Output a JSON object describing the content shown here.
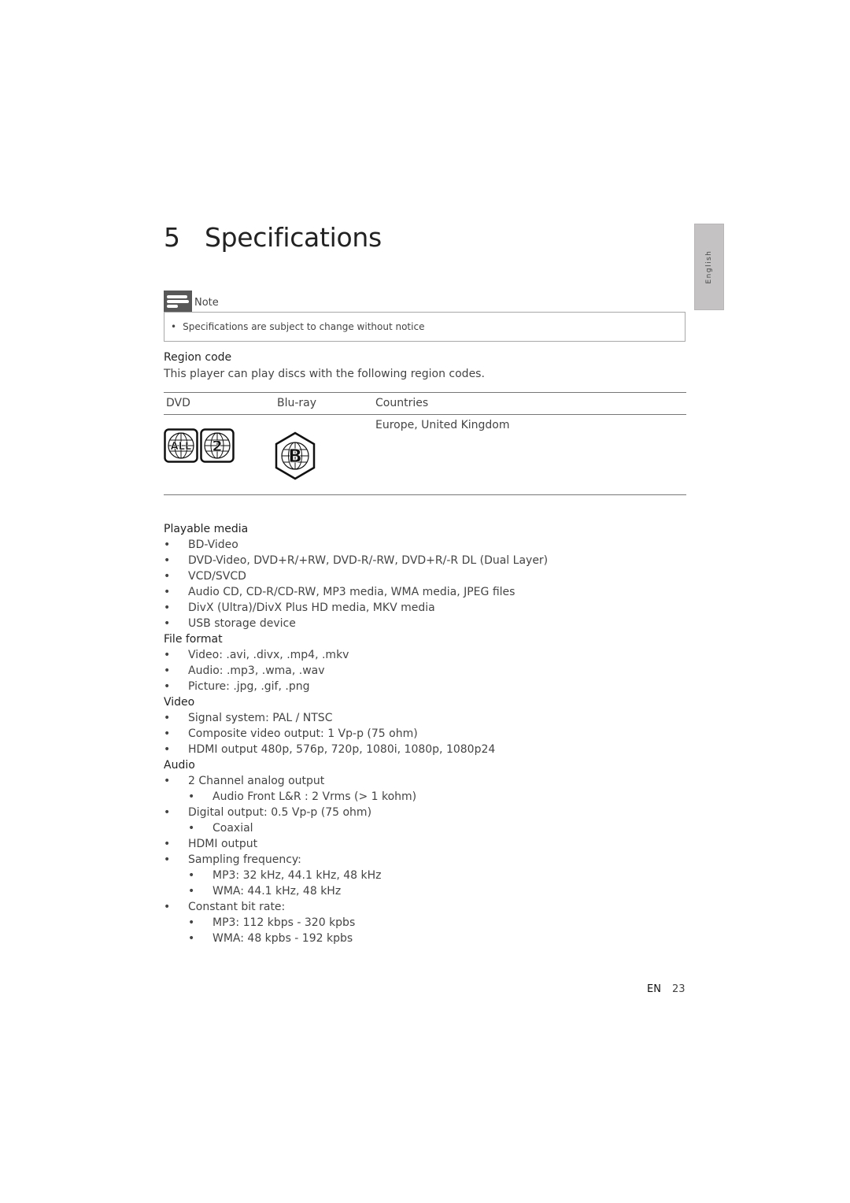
{
  "page": {
    "chapter_number": "5",
    "title": "Specifications",
    "language_tab": "English"
  },
  "note": {
    "icon": "note-icon",
    "label": "Note",
    "bullet": "•",
    "text": "Specifications are subject to change without notice"
  },
  "region": {
    "heading": "Region code",
    "intro": "This player can play discs with the following region codes.",
    "table": {
      "headers": [
        "DVD",
        "Blu-ray",
        "Countries"
      ],
      "rows": [
        {
          "dvd_icons": [
            "region-all-globe-icon",
            "region-2-globe-icon"
          ],
          "dvd_codes": [
            "ALL",
            "2"
          ],
          "bluray_icon": "region-b-hexagon-icon",
          "bluray_code": "B",
          "countries": "Europe, United Kingdom"
        }
      ]
    }
  },
  "sections": [
    {
      "heading": "Playable media",
      "items": [
        {
          "level": 1,
          "text": "BD-Video"
        },
        {
          "level": 1,
          "text": "DVD-Video, DVD+R/+RW, DVD-R/-RW, DVD+R/-R DL (Dual Layer)"
        },
        {
          "level": 1,
          "text": "VCD/SVCD"
        },
        {
          "level": 1,
          "text": "Audio CD, CD-R/CD-RW, MP3 media, WMA media, JPEG files"
        },
        {
          "level": 1,
          "text": "DivX (Ultra)/DivX Plus HD media, MKV media"
        },
        {
          "level": 1,
          "text": "USB storage device"
        }
      ]
    },
    {
      "heading": "File format",
      "items": [
        {
          "level": 1,
          "text": "Video: .avi, .divx, .mp4, .mkv"
        },
        {
          "level": 1,
          "text": "Audio: .mp3, .wma, .wav"
        },
        {
          "level": 1,
          "text": "Picture: .jpg, .gif, .png"
        }
      ]
    },
    {
      "heading": "Video",
      "items": [
        {
          "level": 1,
          "text": "Signal system: PAL / NTSC"
        },
        {
          "level": 1,
          "text": "Composite video output: 1 Vp-p (75 ohm)"
        },
        {
          "level": 1,
          "text": "HDMI output 480p, 576p, 720p, 1080i, 1080p, 1080p24"
        }
      ]
    },
    {
      "heading": "Audio",
      "items": [
        {
          "level": 1,
          "text": "2 Channel analog output"
        },
        {
          "level": 2,
          "text": "Audio Front L&R : 2 Vrms (> 1 kohm)"
        },
        {
          "level": 1,
          "text": "Digital output: 0.5 Vp-p (75 ohm)"
        },
        {
          "level": 2,
          "text": "Coaxial"
        },
        {
          "level": 1,
          "text": "HDMI output"
        },
        {
          "level": 1,
          "text": "Sampling frequency:"
        },
        {
          "level": 2,
          "text": "MP3: 32 kHz, 44.1 kHz, 48 kHz"
        },
        {
          "level": 2,
          "text": "WMA: 44.1 kHz, 48 kHz"
        },
        {
          "level": 1,
          "text": "Constant bit rate:"
        },
        {
          "level": 2,
          "text": "MP3: 112 kbps - 320 kpbs"
        },
        {
          "level": 2,
          "text": "WMA: 48 kpbs - 192 kpbs"
        }
      ]
    }
  ],
  "bullet_glyph": "•",
  "footer": {
    "language_code": "EN",
    "page_number": "23"
  }
}
